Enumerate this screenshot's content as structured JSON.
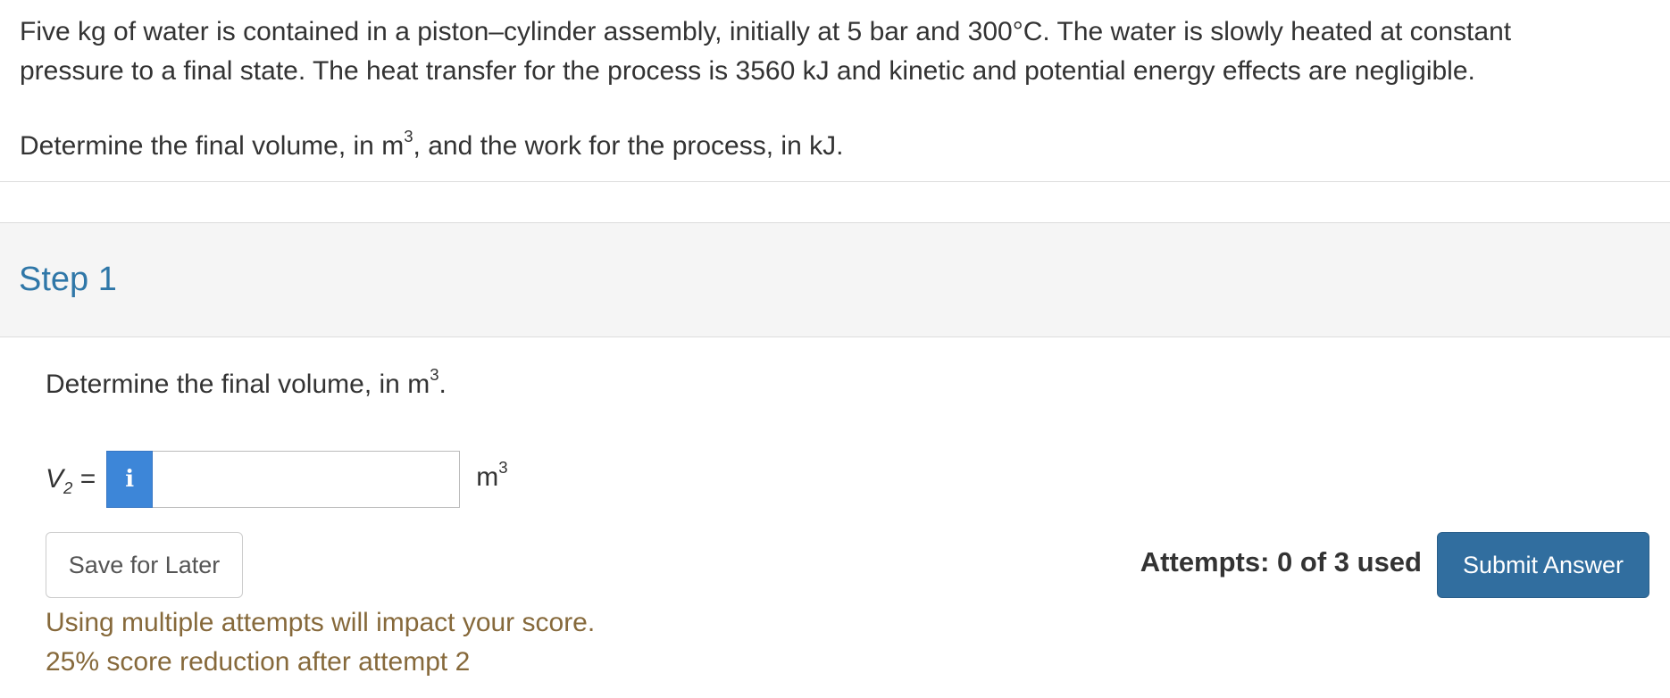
{
  "problem": {
    "line1": "Five kg of water is contained in a piston–cylinder assembly, initially at 5 bar and 300°C. The water is slowly heated at constant",
    "line2": "pressure to a final state. The heat transfer for the process is 3560 kJ and kinetic and potential energy effects are negligible.",
    "question_pre": "Determine the final volume, in m",
    "question_sup": "3",
    "question_post": ", and the work for the process, in kJ."
  },
  "step": {
    "title": "Step 1",
    "prompt_pre": "Determine the final volume, in m",
    "prompt_sup": "3",
    "prompt_post": ".",
    "variable": "V",
    "variable_sub": "2",
    "equals": " =",
    "info_icon_glyph": "i",
    "input_value": "",
    "unit": "m",
    "unit_sup": "3"
  },
  "actions": {
    "save_label": "Save for Later",
    "attempts_text": "Attempts: 0 of 3 used",
    "submit_label": "Submit Answer"
  },
  "warning": {
    "line1": "Using multiple attempts will impact your score.",
    "line2": "25% score reduction after attempt 2"
  },
  "colors": {
    "step_title": "#2f77a8",
    "info_button": "#3d86d8",
    "submit_button": "#316e9f",
    "warning_text": "#86693b",
    "step_header_bg": "#f5f5f5"
  },
  "icons": {
    "info": "info-icon"
  }
}
